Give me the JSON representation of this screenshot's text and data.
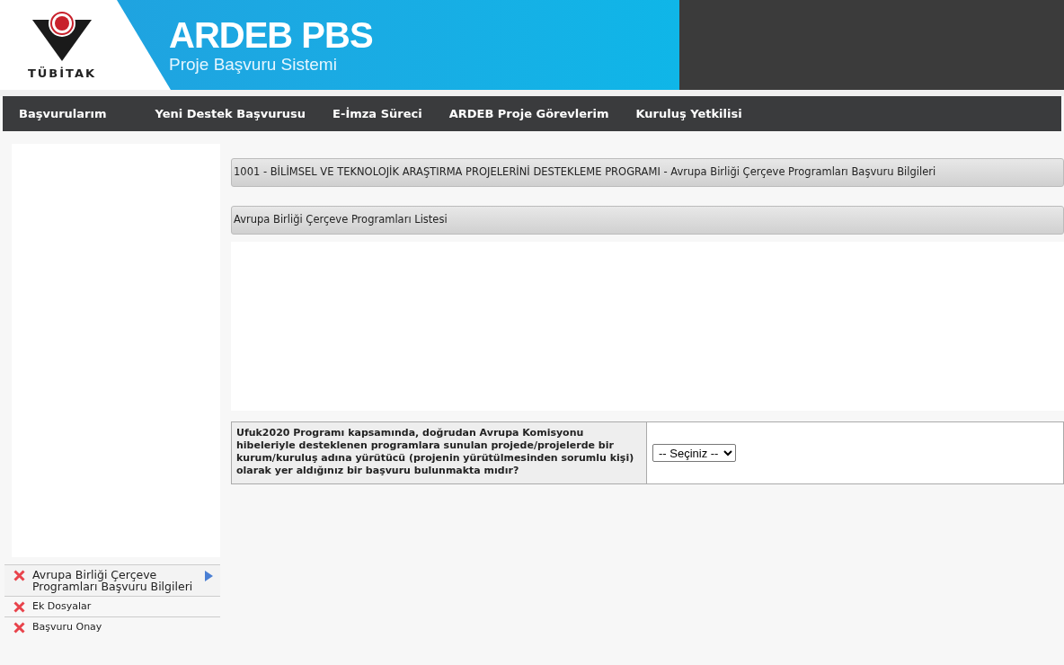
{
  "header": {
    "logo_text": "TÜBİTAK",
    "title": "ARDEB PBS",
    "subtitle": "Proje Başvuru Sistemi"
  },
  "nav": [
    "Başvurularım",
    "Yeni Destek Başvurusu",
    "E-İmza Süreci",
    "ARDEB Proje Görevlerim",
    "Kuruluş Yetkilisi"
  ],
  "sidebar": {
    "items": [
      {
        "label": "Avrupa Birliği Çerçeve Programları Başvuru Bilgileri",
        "complete": false,
        "selected": true
      },
      {
        "label": "Ek Dosyalar",
        "complete": false,
        "selected": false
      },
      {
        "label": "Başvuru Onay",
        "complete": false,
        "selected": false
      }
    ]
  },
  "page_title": "1001 - BİLİMSEL VE TEKNOLOJİK ARAŞTIRMA PROJELERİNİ DESTEKLEME PROGRAMI - Avrupa Birliği Çerçeve Programları Başvuru Bilgileri",
  "section_title": "Avrupa Birliği Çerçeve Programları Listesi",
  "question": {
    "label": "Ufuk2020 Programı kapsamında, doğrudan Avrupa Komisyonu hibeleriyle desteklenen programlara sunulan projede/projelerde bir kurum/kuruluş adına yürütücü (projenin yürütülmesinden sorumlu kişi) olarak yer aldığınız bir başvuru bulunmakta mıdır?",
    "value": "-- Seçiniz --"
  }
}
